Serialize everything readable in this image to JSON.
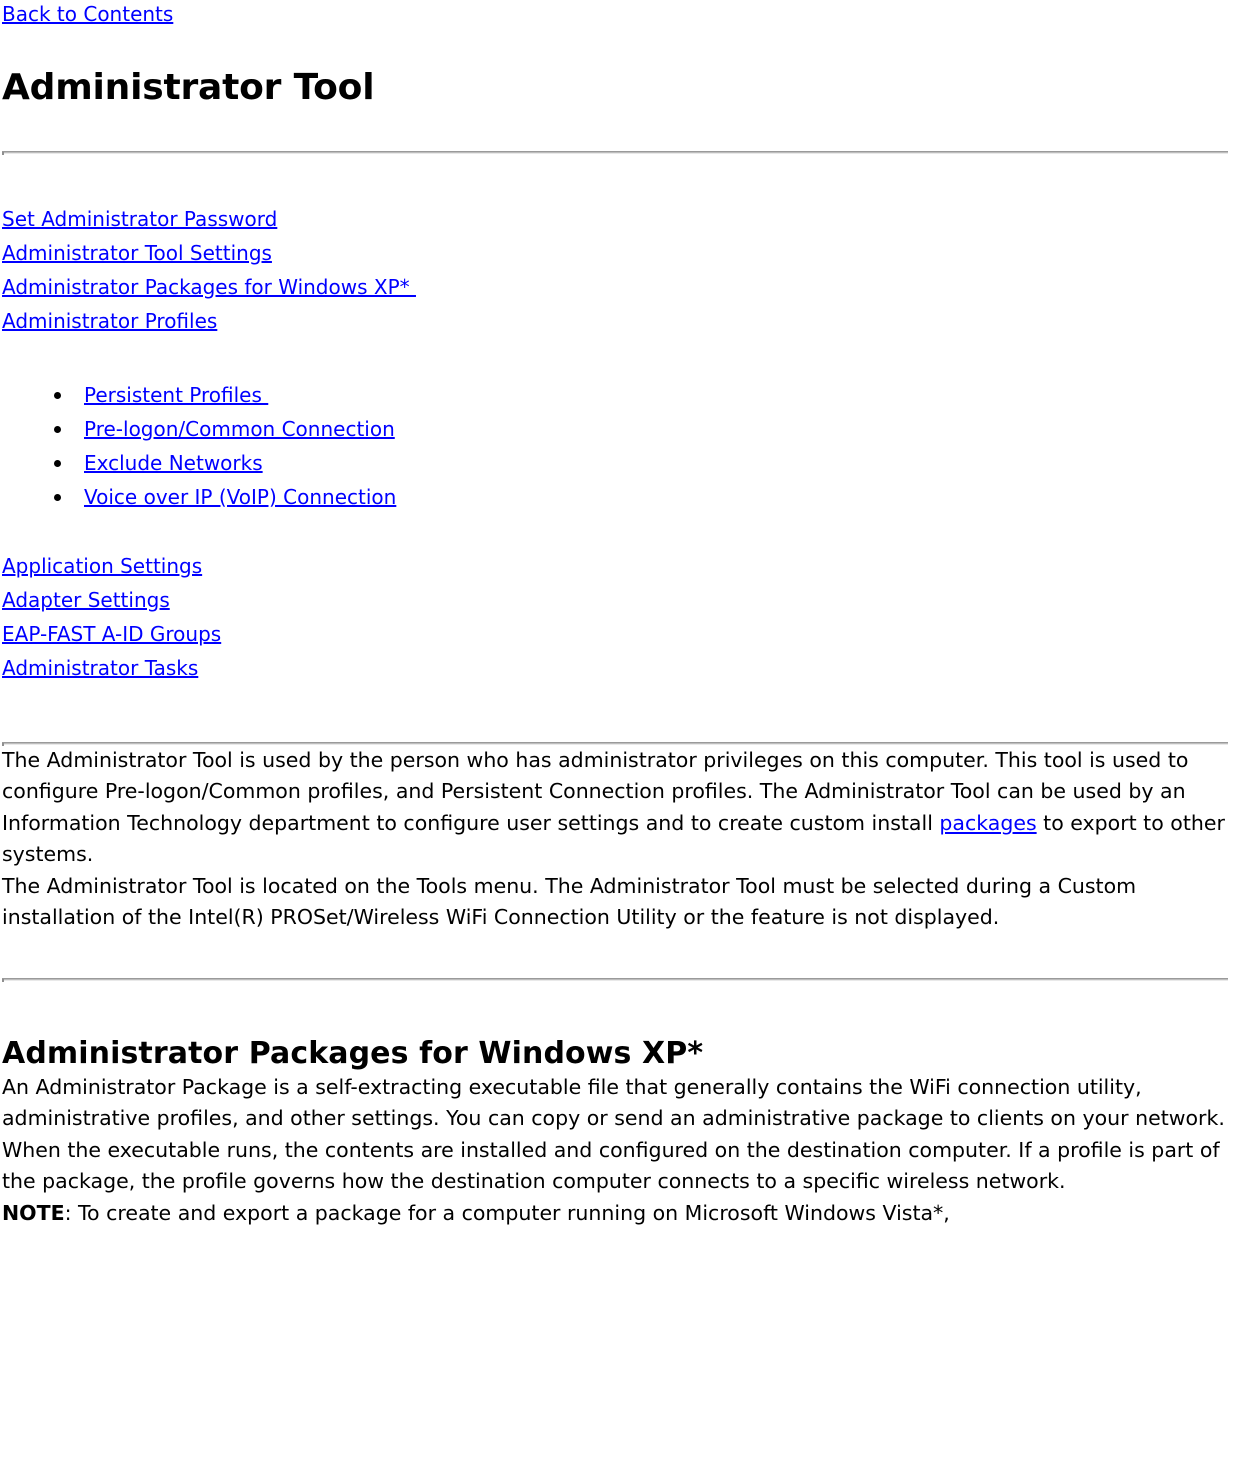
{
  "document": {
    "back_link": "Back to Contents",
    "title": "Administrator Tool",
    "link_color": "#0000FF",
    "text_color": "#000000",
    "background_color": "#FFFFFF"
  },
  "toc_top": {
    "links": [
      "Set Administrator Password",
      "Administrator Tool Settings",
      "Administrator Packages for Windows XP* ",
      "Administrator Profiles"
    ]
  },
  "toc_bullets": {
    "items": [
      "Persistent Profiles ",
      "Pre-logon/Common Connection",
      "Exclude Networks",
      "Voice over IP (VoIP) Connection"
    ]
  },
  "toc_bottom": {
    "links": [
      "Application Settings",
      "Adapter Settings",
      "EAP-FAST A-ID Groups",
      "Administrator Tasks"
    ]
  },
  "intro": {
    "paragraph_1_before": "The Administrator Tool is used by the person who has administrator privileges on this computer. This tool is used to configure Pre-logon/Common profiles, and Persistent Connection profiles. The Administrator Tool can be used by an Information Technology department to configure user settings and to create custom install ",
    "paragraph_1_link": "packages",
    "paragraph_1_after": " to export to other systems.",
    "paragraph_2": "The Administrator Tool is located on the Tools menu. The Administrator Tool must be selected during a Custom installation of the Intel(R) PROSet/Wireless WiFi Connection Utility or the feature is not displayed."
  },
  "packages_section": {
    "heading": "Administrator Packages for Windows XP*",
    "paragraph": "An Administrator Package is a self-extracting executable file that generally contains the WiFi connection utility, administrative profiles, and other settings. You can copy or send an administrative package to clients on your network. When the executable runs, the contents are installed and configured on the destination computer. If a profile is part of the package, the profile governs how the destination computer connects to a specific wireless network.",
    "note_label": "NOTE",
    "note_text": ": To create and export a package for a computer running on Microsoft Windows Vista*,"
  }
}
